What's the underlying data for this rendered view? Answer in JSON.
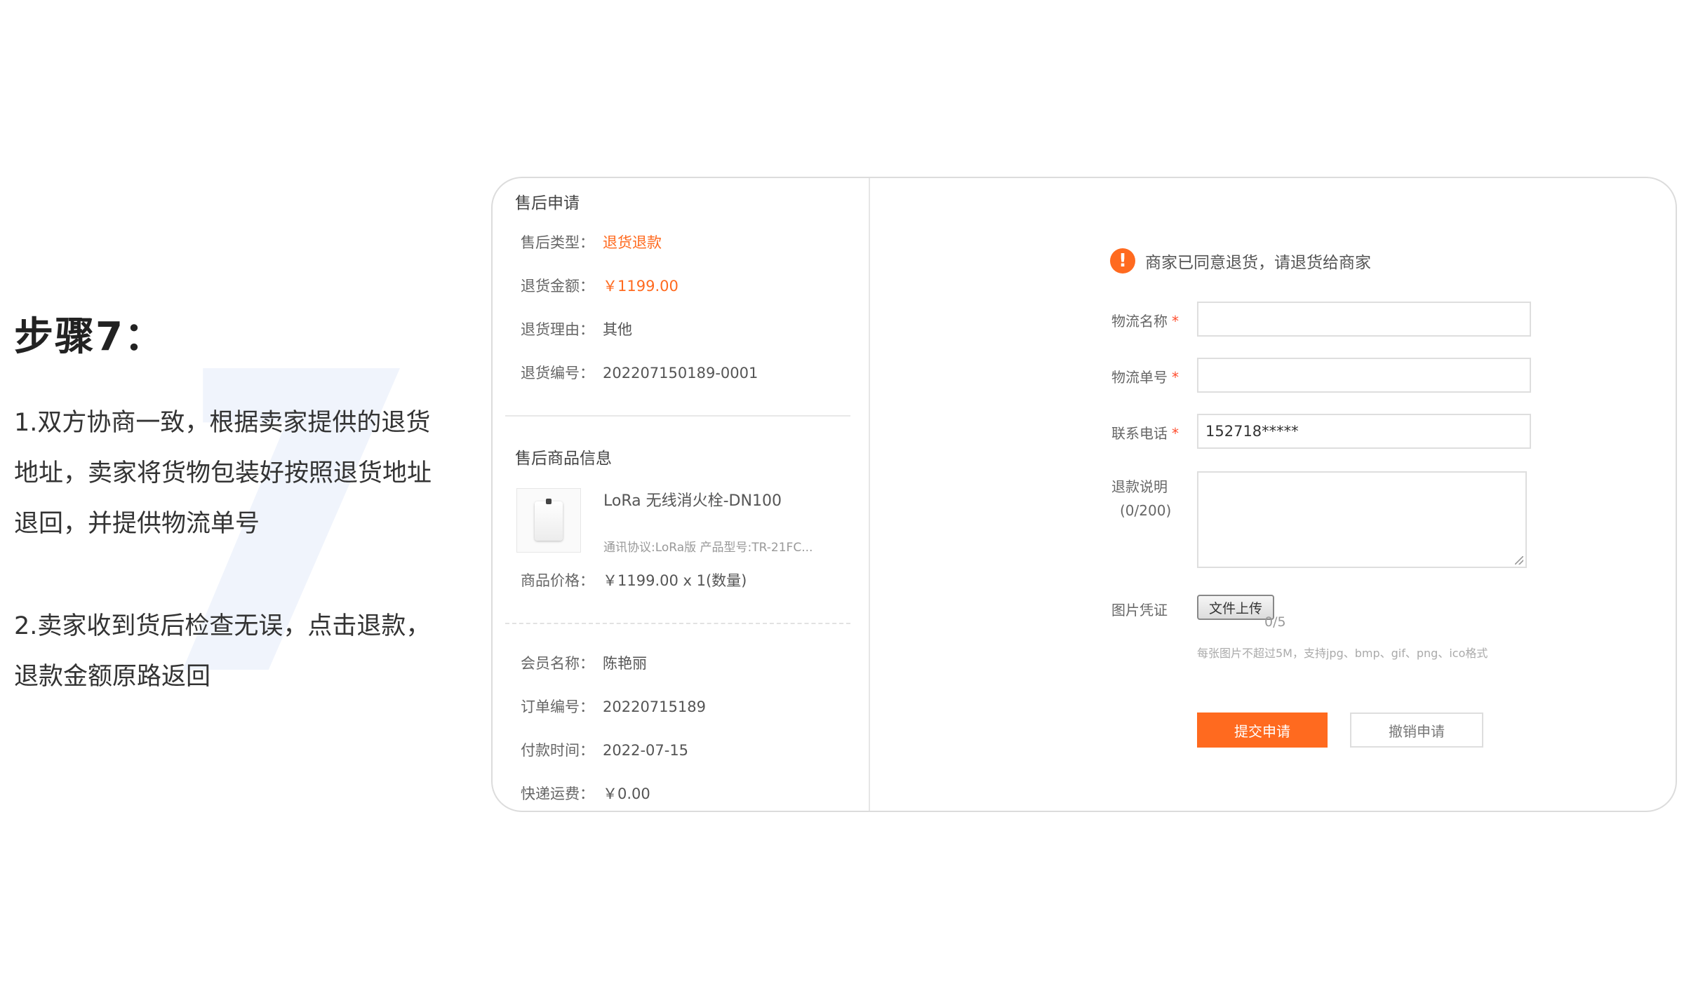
{
  "intro": {
    "step_title": "步骤7：",
    "paragraph1_line1": "1.双方协商一致，根据卖家提供的退货",
    "paragraph1_line2": "地址，卖家将货物包装好按照退货地址",
    "paragraph1_line3": "退回，并提供物流单号",
    "paragraph2_line1": "2.卖家收到货后检查无误，点击退款，",
    "paragraph2_line2": "退款金额原路返回"
  },
  "after_sale": {
    "title": "售后申请",
    "rows": [
      {
        "key": "售后类型：",
        "value": "退货退款"
      },
      {
        "key": "退货金额：",
        "value": "￥1199.00"
      },
      {
        "key": "退货理由：",
        "value": "其他"
      },
      {
        "key": "退货编号：",
        "value": "202207150189-0001"
      }
    ]
  },
  "product": {
    "title": "售后商品信息",
    "name": "LoRa 无线消火栓-DN100",
    "spec": "通讯协议:LoRa版 产品型号:TR-21FC...",
    "price_key": "商品价格：",
    "price_value": "￥1199.00 x 1(数量)"
  },
  "order": {
    "rows": [
      {
        "key": "会员名称：",
        "value": "陈艳丽"
      },
      {
        "key": "订单编号：",
        "value": "20220715189"
      },
      {
        "key": "付款时间：",
        "value": "2022-07-15"
      },
      {
        "key": "快递运费：",
        "value": "￥0.00"
      }
    ]
  },
  "form": {
    "notice": "商家已同意退货，请退货给商家",
    "notice_icon": "!",
    "logistics_name_label": "物流名称",
    "logistics_no_label": "物流单号",
    "phone_label": "联系电话",
    "required_mark": "*",
    "phone_value": "152718*****",
    "refund_note_label": "退款说明",
    "refund_note_count": "(0/200)",
    "image_label": "图片凭证",
    "upload_button": "文件上传",
    "upload_count": "0/5",
    "upload_hint": "每张图片不超过5M，支持jpg、bmp、gif、png、ico格式",
    "submit_button": "提交申请",
    "cancel_button": "撤销申请"
  },
  "colors": {
    "accent": "#ff6a1f"
  }
}
